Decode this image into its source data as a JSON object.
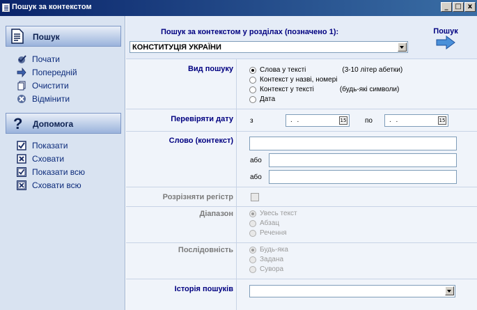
{
  "window": {
    "title": "Пошук за контекстом",
    "buttons": [
      "_",
      "□",
      "x"
    ]
  },
  "sidebar": {
    "search_header": "Пошук",
    "search_items": [
      {
        "label": "Почати",
        "icon": "check-icon"
      },
      {
        "label": "Попередній",
        "icon": "arrow-right-icon"
      },
      {
        "label": "Очистити",
        "icon": "pages-icon"
      },
      {
        "label": "Відмінити",
        "icon": "cancel-icon"
      }
    ],
    "help_header": "Допомога",
    "help_items": [
      {
        "label": "Показати",
        "icon": "checkbox-checked-icon"
      },
      {
        "label": "Сховати",
        "icon": "checkbox-x-icon"
      },
      {
        "label": "Показати всю",
        "icon": "checkbox-checked-framed-icon"
      },
      {
        "label": "Сховати всю",
        "icon": "checkbox-x-framed-icon"
      }
    ]
  },
  "header": {
    "title": "Пошук за контекстом у розділах (позначено 1):",
    "section_select_value": "КОНСТИТУЦІЯ УКРАЇНИ",
    "go_label": "Пошук"
  },
  "search_type": {
    "label": "Вид пошуку",
    "options": [
      {
        "label": "Слова у тексті",
        "note": "(3-10 літер абетки)",
        "selected": true
      },
      {
        "label": "Контекст у назві, номері",
        "note": "",
        "selected": false
      },
      {
        "label": "Контекст у тексті",
        "note": "(будь-які символи)",
        "selected": false
      },
      {
        "label": "Дата",
        "note": "",
        "selected": false
      }
    ]
  },
  "date_check": {
    "label": "Перевіряти дату",
    "from_label": "з",
    "to_label": "по",
    "from_value": ". .",
    "to_value": ". ."
  },
  "word": {
    "label": "Слово (контекст)",
    "or_label": "або",
    "value1": "",
    "value2": "",
    "value3": ""
  },
  "case": {
    "label": "Розрізняти регістр",
    "checked": false
  },
  "range": {
    "label": "Діапазон",
    "options": [
      {
        "label": "Увесь текст",
        "selected": true
      },
      {
        "label": "Абзац",
        "selected": false
      },
      {
        "label": "Речення",
        "selected": false
      }
    ]
  },
  "sequence": {
    "label": "Послідовність",
    "options": [
      {
        "label": "Будь-яка",
        "selected": true
      },
      {
        "label": "Задана",
        "selected": false
      },
      {
        "label": "Сувора",
        "selected": false
      }
    ]
  },
  "history": {
    "label": "Історія пошуків",
    "value": ""
  },
  "colors": {
    "title_bar": "#0a246a",
    "sidebar_bg": "#d9e3f1",
    "label_blue": "#000080",
    "main_bg": "#f0f4fa"
  }
}
